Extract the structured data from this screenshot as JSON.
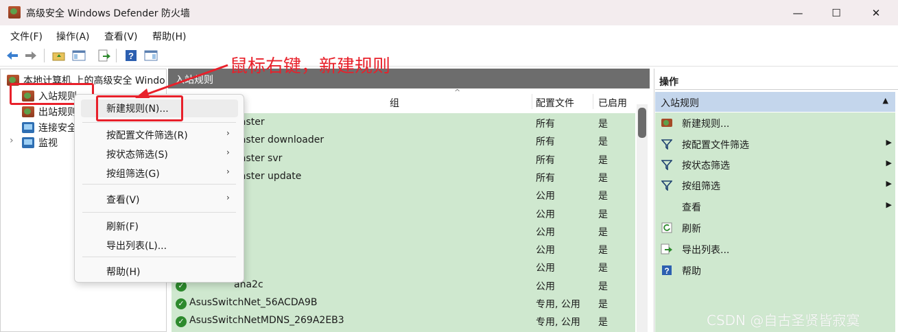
{
  "window": {
    "title": "高级安全 Windows Defender 防火墙",
    "min_glyph": "—",
    "max_glyph": "☐",
    "close_glyph": "✕"
  },
  "menubar": [
    "文件(F)",
    "操作(A)",
    "查看(V)",
    "帮助(H)"
  ],
  "toolbar": [
    "back-icon",
    "forward-icon",
    "folder-up-icon",
    "show-tree-icon",
    "export-icon",
    "help-icon",
    "show-action-pane-icon"
  ],
  "tree": {
    "root": "本地计算机 上的高级安全 Windo",
    "items": [
      "入站规则",
      "出站规则",
      "连接安全",
      "监视"
    ],
    "expand_glyph": "›"
  },
  "center": {
    "header": "入站规则",
    "columns": [
      "组",
      "配置文件",
      "已启用"
    ],
    "sort_glyph": "^",
    "rows": [
      {
        "name": "naster",
        "profile": "所有",
        "enabled": "是"
      },
      {
        "name": "naster downloader",
        "profile": "所有",
        "enabled": "是"
      },
      {
        "name": "naster svr",
        "profile": "所有",
        "enabled": "是"
      },
      {
        "name": "naster update",
        "profile": "所有",
        "enabled": "是"
      },
      {
        "name": "",
        "profile": "公用",
        "enabled": "是"
      },
      {
        "name": "",
        "profile": "公用",
        "enabled": "是"
      },
      {
        "name": "",
        "profile": "公用",
        "enabled": "是"
      },
      {
        "name": "",
        "profile": "公用",
        "enabled": "是"
      },
      {
        "name": "",
        "profile": "公用",
        "enabled": "是"
      },
      {
        "name": "ana2c",
        "profile": "公用",
        "enabled": "是"
      },
      {
        "name": "AsusSwitchNet_56ACDA9B",
        "profile": "专用, 公用",
        "enabled": "是"
      },
      {
        "name": "AsusSwitchNetMDNS_269A2EB3",
        "profile": "专用, 公用",
        "enabled": "是"
      }
    ],
    "check_glyph": "✓"
  },
  "actions": {
    "title": "操作",
    "section": "入站规则",
    "section_caret": "▲",
    "items": [
      {
        "label": "新建规则...",
        "icon": "new-rule-icon",
        "arrow": ""
      },
      {
        "label": "按配置文件筛选",
        "icon": "filter-icon",
        "arrow": "▶"
      },
      {
        "label": "按状态筛选",
        "icon": "filter-icon",
        "arrow": "▶"
      },
      {
        "label": "按组筛选",
        "icon": "filter-icon",
        "arrow": "▶"
      },
      {
        "label": "查看",
        "icon": "",
        "arrow": "▶"
      },
      {
        "label": "刷新",
        "icon": "refresh-icon",
        "arrow": ""
      },
      {
        "label": "导出列表...",
        "icon": "export-list-icon",
        "arrow": ""
      },
      {
        "label": "帮助",
        "icon": "help-icon",
        "arrow": ""
      }
    ]
  },
  "context_menu": {
    "items": [
      {
        "label": "新建规则(N)...",
        "arrow": ""
      },
      {
        "label": "按配置文件筛选(R)",
        "arrow": "›"
      },
      {
        "label": "按状态筛选(S)",
        "arrow": "›"
      },
      {
        "label": "按组筛选(G)",
        "arrow": "›"
      },
      {
        "label": "查看(V)",
        "arrow": "›"
      },
      {
        "label": "刷新(F)",
        "arrow": ""
      },
      {
        "label": "导出列表(L)...",
        "arrow": ""
      },
      {
        "label": "帮助(H)",
        "arrow": ""
      }
    ]
  },
  "annotation": "鼠标右键，新建规则",
  "watermark": "CSDN @自古圣贤皆寂寞",
  "colors": {
    "accent_red": "#e8202a",
    "row_green": "#cfe8cf",
    "header_gray": "#6d6d6d",
    "section_blue": "#c4d6ec"
  }
}
